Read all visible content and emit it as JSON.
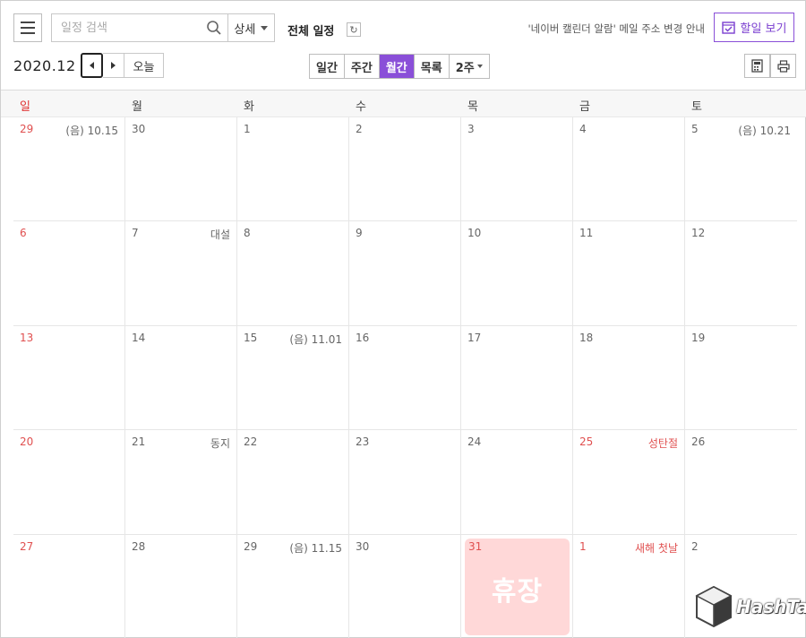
{
  "topbar": {
    "search_placeholder": "일정 검색",
    "detail_label": "상세",
    "calendar_title": "전체 일정",
    "notice": "'네이버 캘린더 알람' 메일 주소 변경 안내",
    "todo_label": "할일 보기"
  },
  "nav": {
    "month": "2020.12",
    "today_label": "오늘"
  },
  "views": {
    "day": "일간",
    "week": "주간",
    "month": "월간",
    "list": "목록",
    "two_week": "2주"
  },
  "weekdays": [
    "일",
    "월",
    "화",
    "수",
    "목",
    "금",
    "토"
  ],
  "weeks": [
    [
      {
        "num": "29",
        "note": "(음) 10.15"
      },
      {
        "num": "30",
        "note": ""
      },
      {
        "num": "1",
        "note": ""
      },
      {
        "num": "2",
        "note": ""
      },
      {
        "num": "3",
        "note": ""
      },
      {
        "num": "4",
        "note": ""
      },
      {
        "num": "5",
        "note": "(음) 10.21"
      }
    ],
    [
      {
        "num": "6",
        "note": ""
      },
      {
        "num": "7",
        "note": "대설"
      },
      {
        "num": "8",
        "note": ""
      },
      {
        "num": "9",
        "note": ""
      },
      {
        "num": "10",
        "note": ""
      },
      {
        "num": "11",
        "note": ""
      },
      {
        "num": "12",
        "note": ""
      }
    ],
    [
      {
        "num": "13",
        "note": ""
      },
      {
        "num": "14",
        "note": ""
      },
      {
        "num": "15",
        "note": "(음) 11.01"
      },
      {
        "num": "16",
        "note": ""
      },
      {
        "num": "17",
        "note": ""
      },
      {
        "num": "18",
        "note": ""
      },
      {
        "num": "19",
        "note": ""
      }
    ],
    [
      {
        "num": "20",
        "note": ""
      },
      {
        "num": "21",
        "note": "동지"
      },
      {
        "num": "22",
        "note": ""
      },
      {
        "num": "23",
        "note": ""
      },
      {
        "num": "24",
        "note": ""
      },
      {
        "num": "25",
        "note": "성탄절"
      },
      {
        "num": "26",
        "note": ""
      }
    ],
    [
      {
        "num": "27",
        "note": ""
      },
      {
        "num": "28",
        "note": ""
      },
      {
        "num": "29",
        "note": "(음) 11.15"
      },
      {
        "num": "30",
        "note": ""
      },
      {
        "num": "31",
        "note": "휴장"
      },
      {
        "num": "1",
        "note": "새해 첫날"
      },
      {
        "num": "2",
        "note": ""
      }
    ]
  ],
  "watermark": "HashTag",
  "colors": {
    "accent": "#8a4fd8",
    "holiday_red": "#e05050",
    "closed_block": "#ffd8d8"
  }
}
